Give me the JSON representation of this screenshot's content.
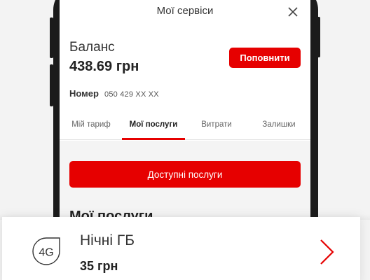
{
  "colors": {
    "accent": "#e60000",
    "text": "#333333",
    "background": "#f3f3f3"
  },
  "sheet": {
    "title": "Мої сервіси",
    "close_icon": "close-icon"
  },
  "balance": {
    "label": "Баланс",
    "value": "438.69 грн",
    "topup_label": "Поповнити"
  },
  "number": {
    "label": "Номер",
    "value": "050 429 XX XX"
  },
  "tabs": [
    {
      "label": "Мій тариф"
    },
    {
      "label": "Мої послуги",
      "active": true
    },
    {
      "label": "Витрати"
    },
    {
      "label": "Залишки"
    }
  ],
  "services": {
    "available_button": "Доступні послуги",
    "section_title": "Мої послуги"
  },
  "card": {
    "icon_text": "4G",
    "icon": "4g-drop-icon",
    "title": "Нічні ГБ",
    "price": "35 грн",
    "chevron_icon": "chevron-right-icon"
  }
}
